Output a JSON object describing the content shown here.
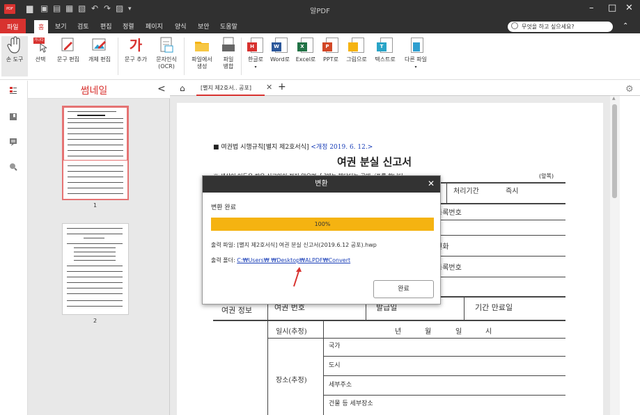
{
  "app": {
    "title": "알PDF",
    "logo_text": "PDF",
    "window_controls": [
      "–",
      "□",
      "✕"
    ]
  },
  "menu": {
    "file": "파일",
    "items": [
      "홈",
      "보기",
      "검토",
      "편집",
      "정렬",
      "페이지",
      "양식",
      "보안",
      "도움말"
    ],
    "active_index": 0,
    "search_placeholder": "무엇을 하고 싶으세요?",
    "collapse": "⌃"
  },
  "ribbon": {
    "hand_tool": "손 도구",
    "select": "선택",
    "select_badge": "가나다",
    "text_edit": "문구 편집",
    "object_edit": "개체 편집",
    "add_text": "문구 추가",
    "add_text_glyph": "가",
    "ocr_line1": "문자인식",
    "ocr_line2": "(OCR)",
    "create_line1": "파일에서",
    "create_line2": "생성",
    "merge_line1": "파일",
    "merge_line2": "병합",
    "to_hwp": "한글로",
    "to_word": "Word로",
    "to_excel": "Excel로",
    "to_ppt": "PPT로",
    "to_image": "그림으로",
    "to_text": "텍스트로",
    "to_other": "다른 파일",
    "badge_h": "H",
    "badge_w": "W",
    "badge_x": "X",
    "badge_p": "P",
    "badge_t": "T"
  },
  "colors": {
    "accent": "#d8322f",
    "titlebar": "#303030",
    "progress": "#f5b311",
    "link": "#1a3fb8",
    "hwp": "#d8322f",
    "word": "#2b579a",
    "excel": "#217346",
    "ppt": "#d24726",
    "image": "#f5b311",
    "text": "#29a4c7"
  },
  "thumbnails": {
    "title": "썸네일",
    "collapse": "<",
    "pages": [
      "1",
      "2"
    ]
  },
  "tabs": {
    "doc_title": "[별지 제2호서.. 공포]",
    "close": "✕",
    "add": "+"
  },
  "document": {
    "header": "■ 여권법 시행규칙[별지 제2호서식]",
    "revision": "<개정 2019. 6. 12.>",
    "title": "여권 분실 신고서",
    "note": "※ 색상이 어두운 칸은 신고인이 적지 않으며, [ ]에는 해당되는 곳에 √표를 합니다.",
    "side": "(앞쪽)",
    "processing_period": "처리기간",
    "immediately": "즉시",
    "reg_no_1": "등록번호",
    "phone": "전화",
    "reg_no_2": "등록번호",
    "passport_info": "여권 정보",
    "passport_no": "여권 번호",
    "issue_date": "발급일",
    "expiry": "기간 만료일",
    "datetime_label": "일시(추정)",
    "year": "년",
    "month": "월",
    "day": "일",
    "hour": "시",
    "place_label": "장소(추정)",
    "country": "국가",
    "city": "도시",
    "address": "세부주소",
    "building": "건물 등 세부장소"
  },
  "dialog": {
    "title": "변환",
    "close": "✕",
    "status": "변환 완료",
    "progress": 100,
    "progress_label": "100%",
    "output_file_label": "출력 파일:",
    "output_file": "[별지 제2호서식] 여권 분실 신고서(2019.6.12 공포).hwp",
    "output_folder_label": "출력 폴더:",
    "output_folder": "C:₩Users₩        ₩Desktop₩ALPDF₩Convert",
    "ok": "완료"
  }
}
